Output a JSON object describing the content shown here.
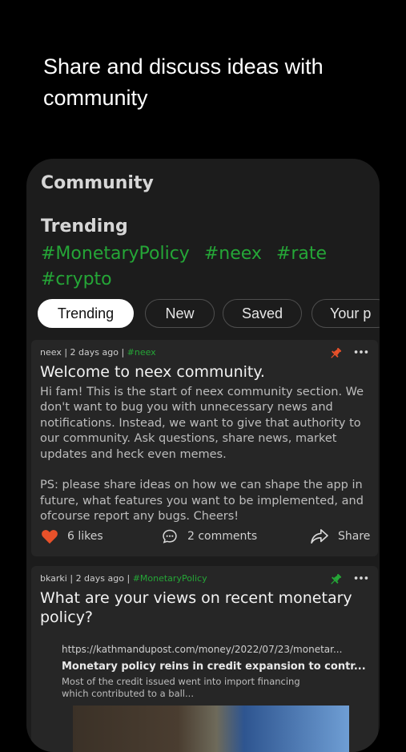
{
  "promo": {
    "headline": "Share and discuss ideas with community"
  },
  "screen": {
    "title": "Community",
    "trending_title": "Trending",
    "trending_tags": [
      "#MonetaryPolicy",
      "#neex",
      "#rate",
      "#crypto"
    ],
    "tabs": [
      {
        "label": "Trending",
        "active": true
      },
      {
        "label": "New",
        "active": false
      },
      {
        "label": "Saved",
        "active": false
      },
      {
        "label": "Your p",
        "active": false
      }
    ]
  },
  "posts": [
    {
      "author": "neex",
      "time": "2 days ago",
      "tag": "#neex",
      "pin_color": "#e8512a",
      "title": "Welcome to neex community.",
      "body": "Hi fam! This is the start of neex community section. We don't want to bug you with unnecessary news and notifications. Instead, we want to give that authority to our community. Ask questions, share news, market updates and heck even memes.\n\nPS: please share ideas on how we can shape the app in future, what features you want to be implemented, and ofcourse report any bugs. Cheers!",
      "likes": "6 likes",
      "comments": "2 comments",
      "share": "Share"
    },
    {
      "author": "bkarki",
      "time": "2 days ago",
      "tag": "#MonetaryPolicy",
      "pin_color": "#25a637",
      "title": "What are your views on recent monetary policy?",
      "link": {
        "url": "https://kathmandupost.com/money/2022/07/23/monetar...",
        "title": "Monetary policy reins in credit expansion to contr...",
        "description": "Most of the credit issued went into import financing which contributed to a ball..."
      }
    }
  ],
  "colors": {
    "accent_green": "#25a637",
    "like_heart": "#e8512a",
    "background": "#000000",
    "card": "#262626"
  }
}
